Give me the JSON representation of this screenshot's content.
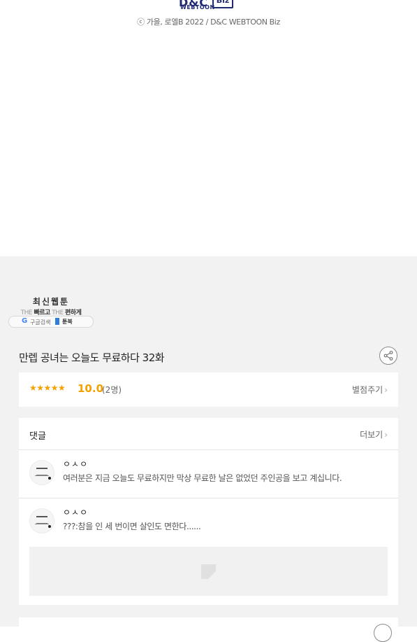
{
  "footer": {
    "logo_mark": "D&C",
    "logo_word": "WEBTOON",
    "logo_biz": "Biz",
    "copyright": "ⓒ 가을, 로엘B 2022 / D&C WEBTOON Biz"
  },
  "banner": {
    "title": "최신웹툰",
    "sub_the1": "THE",
    "sub_fast": "빠르고",
    "sub_the2": "THE",
    "sub_easy": "편하게",
    "pill_g": "G",
    "pill_google": "구글검색",
    "pill_site": "툰북"
  },
  "episode": {
    "title": "만렙 공녀는 오늘도 무료하다 32화",
    "share_icon": "share-icon"
  },
  "rating": {
    "stars": "★★★★★",
    "score": "10.0",
    "count": "(2명)",
    "rate_link": "별점주기",
    "chevron": "›",
    "star_color": "#f4a100"
  },
  "comments": {
    "title": "댓글",
    "more": "더보기",
    "chevron": "›",
    "items": [
      {
        "name": "ㅇㅅㅇ",
        "text": "여러분은 지금 오늘도 무료하지만 막상 무료한 날은 없었던 주인공을 보고 계십니다."
      },
      {
        "name": "ㅇㅅㅇ",
        "text": "???:참을 인 세 번이면 살인도 면한다......"
      }
    ]
  }
}
